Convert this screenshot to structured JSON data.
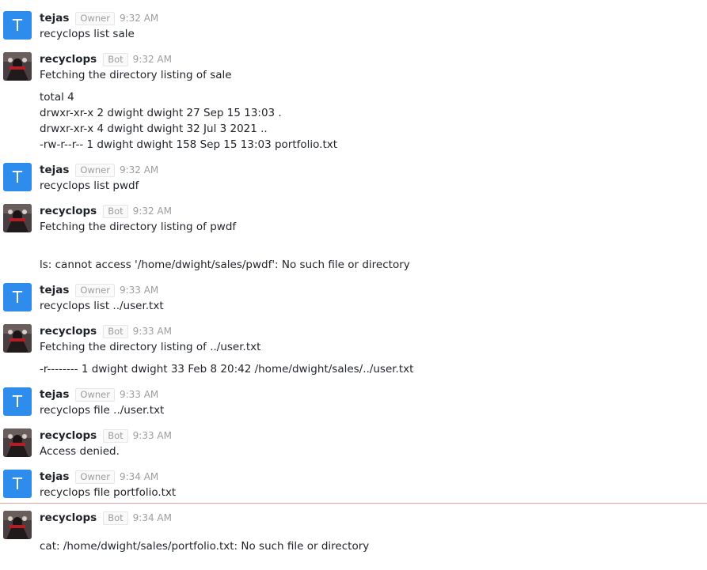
{
  "messages": [
    {
      "user": "tejas",
      "badge": "Owner",
      "time": "9:32 AM",
      "avatar_letter": "T",
      "lines": [
        "recyclops list sale"
      ]
    },
    {
      "user": "recyclops",
      "badge": "Bot",
      "time": "9:32 AM",
      "lines": [
        "Fetching the directory listing of sale",
        "total 4",
        "drwxr-xr-x 2 dwight dwight 27 Sep 15 13:03 .",
        "drwxr-xr-x 4 dwight dwight 32 Jul 3 2021 ..",
        "-rw-r--r-- 1 dwight dwight 158 Sep 15 13:03 portfolio.txt"
      ]
    },
    {
      "user": "tejas",
      "badge": "Owner",
      "time": "9:32 AM",
      "avatar_letter": "T",
      "lines": [
        "recyclops list pwdf"
      ]
    },
    {
      "user": "recyclops",
      "badge": "Bot",
      "time": "9:32 AM",
      "lines": [
        "Fetching the directory listing of pwdf",
        "ls: cannot access '/home/dwight/sales/pwdf': No such file or directory"
      ]
    },
    {
      "user": "tejas",
      "badge": "Owner",
      "time": "9:33 AM",
      "avatar_letter": "T",
      "lines": [
        "recyclops list ../user.txt"
      ]
    },
    {
      "user": "recyclops",
      "badge": "Bot",
      "time": "9:33 AM",
      "lines": [
        "Fetching the directory listing of ../user.txt",
        "-r-------- 1 dwight dwight 33 Feb 8 20:42 /home/dwight/sales/../user.txt"
      ]
    },
    {
      "user": "tejas",
      "badge": "Owner",
      "time": "9:33 AM",
      "avatar_letter": "T",
      "lines": [
        "recyclops file ../user.txt"
      ]
    },
    {
      "user": "recyclops",
      "badge": "Bot",
      "time": "9:33 AM",
      "lines": [
        "Access denied."
      ]
    },
    {
      "user": "tejas",
      "badge": "Owner",
      "time": "9:34 AM",
      "avatar_letter": "T",
      "lines": [
        "recyclops file portfolio.txt"
      ]
    },
    {
      "user": "recyclops",
      "badge": "Bot",
      "time": "9:34 AM",
      "lines": [
        "cat: /home/dwight/sales/portfolio.txt: No such file or directory"
      ]
    }
  ],
  "colors": {
    "avatar_blue": "#2d8cec",
    "new_message_line": "#e8a0a0",
    "meta_gray": "#9a9da1"
  }
}
